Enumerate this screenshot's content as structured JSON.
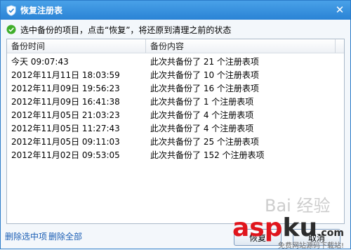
{
  "window": {
    "title": "恢复注册表",
    "close_glyph": "✕"
  },
  "hint": {
    "text": "选中备份的项目，点击“恢复”，将还原到清理之前的状态"
  },
  "table": {
    "columns": [
      "备份时间",
      "备份内容"
    ],
    "rows": [
      {
        "time": "今天 09:07:43",
        "content": "此次共备份了 21 个注册表项"
      },
      {
        "time": "2012年11月11日 18:03:59",
        "content": "此次共备份了 10 个注册表项"
      },
      {
        "time": "2012年11月09日 19:56:23",
        "content": "此次共备份了 16 个注册表项"
      },
      {
        "time": "2012年11月09日 16:41:38",
        "content": "此次共备份了 1 个注册表项"
      },
      {
        "time": "2012年11月05日 21:03:23",
        "content": "此次共备份了 4 个注册表项"
      },
      {
        "time": "2012年11月05日 11:27:43",
        "content": "此次共备份了 4 个注册表项"
      },
      {
        "time": "2012年11月05日 09:11:03",
        "content": "此次共备份了 25 个注册表项"
      },
      {
        "time": "2012年11月02日 09:53:05",
        "content": "此次共备份了 152 个注册表项"
      }
    ]
  },
  "footer": {
    "delete_selected": "删除选中项",
    "delete_all": "删除全部",
    "restore": "恢复",
    "cancel": "取消"
  },
  "watermark": {
    "baidu": "Bai 经验",
    "logo_a": "asp",
    "logo_b": "ku",
    "logo_suffix": ".com",
    "sub": "免费网站源码下载站!"
  },
  "colors": {
    "titlebar": "#2a83d5",
    "link": "#1c5fb5",
    "check": "#3fae2a"
  }
}
